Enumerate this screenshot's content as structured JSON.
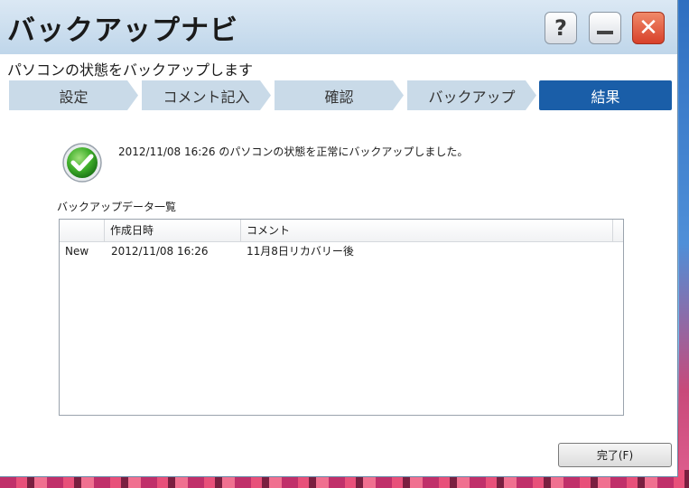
{
  "window": {
    "title": "バックアップナビ",
    "subtitle": "パソコンの状態をバックアップします",
    "buttons": {
      "help_glyph": "?",
      "close_glyph": "✕"
    }
  },
  "steps": [
    {
      "label": "設定",
      "active": false
    },
    {
      "label": "コメント記入",
      "active": false
    },
    {
      "label": "確認",
      "active": false
    },
    {
      "label": "バックアップ",
      "active": false
    },
    {
      "label": "結果",
      "active": true
    }
  ],
  "result": {
    "icon": "check-icon",
    "message": "2012/11/08 16:26 のパソコンの状態を正常にバックアップしました。"
  },
  "list": {
    "title": "バックアップデータ一覧",
    "columns": [
      "",
      "作成日時",
      "コメント"
    ],
    "rows": [
      {
        "tag": "New",
        "date": "2012/11/08 16:26",
        "comment": "11月8日リカバリー後"
      }
    ]
  },
  "footer": {
    "done_label": "完了(F)"
  },
  "colors": {
    "active_step": "#1a5ea8",
    "inactive_step": "#c9dae8",
    "titlebar": "#bfd6ea",
    "close_button": "#d8402a"
  }
}
